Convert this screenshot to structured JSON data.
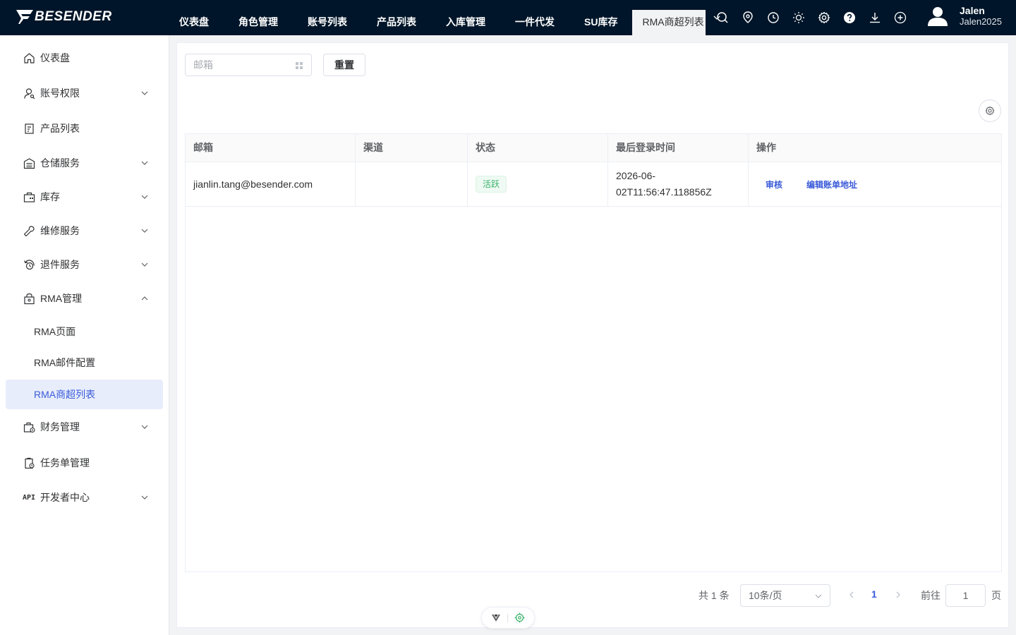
{
  "brand": {
    "name": "BESENDER"
  },
  "topnav": {
    "items": [
      {
        "label": "仪表盘"
      },
      {
        "label": "角色管理"
      },
      {
        "label": "账号列表"
      },
      {
        "label": "产品列表"
      },
      {
        "label": "入库管理"
      },
      {
        "label": "一件代发"
      },
      {
        "label": "SU库存"
      }
    ],
    "active": {
      "label": "RMA商超列表"
    },
    "icons": [
      "search-icon",
      "location-icon",
      "clock-icon",
      "sun-icon",
      "gear-icon",
      "help-icon",
      "download-icon",
      "plus-circle-icon"
    ]
  },
  "user": {
    "name": "Jalen",
    "username": "Jalen2025"
  },
  "sidebar": {
    "items": [
      {
        "label": "仪表盘",
        "icon": "home-icon"
      },
      {
        "label": "账号权限",
        "icon": "user-key-icon"
      },
      {
        "label": "产品列表",
        "icon": "clipboard-icon"
      },
      {
        "label": "仓储服务",
        "icon": "warehouse-icon"
      },
      {
        "label": "库存",
        "icon": "inventory-icon"
      },
      {
        "label": "维修服务",
        "icon": "wrench-icon"
      },
      {
        "label": "退件服务",
        "icon": "return-icon"
      },
      {
        "label": "RMA管理",
        "icon": "lock-bag-icon"
      },
      {
        "label": "财务管理",
        "icon": "finance-icon"
      },
      {
        "label": "任务单管理",
        "icon": "task-icon"
      },
      {
        "label": "开发者中心",
        "icon": "api-icon",
        "tag": "API"
      }
    ],
    "rma_sub": [
      {
        "label": "RMA页面"
      },
      {
        "label": "RMA邮件配置"
      },
      {
        "label": "RMA商超列表"
      }
    ]
  },
  "filters": {
    "email_placeholder": "邮箱",
    "reset_label": "重置"
  },
  "table": {
    "columns": [
      "邮箱",
      "渠道",
      "状态",
      "最后登录时间",
      "操作"
    ],
    "rows": [
      {
        "email": "jianlin.tang@besender.com",
        "channel": "",
        "status": "活跃",
        "last_login_line1": "2026-06-",
        "last_login_line2": "02T11:56:47.118856Z",
        "action_review": "审核",
        "action_edit": "编辑账单地址"
      }
    ]
  },
  "pagination": {
    "total": "共 1 条",
    "page_size": "10条/页",
    "current_page": "1",
    "goto_label": "前往",
    "goto_value": "1",
    "page_suffix": "页"
  },
  "colors": {
    "topbar_bg": "#001529",
    "accent": "#3a5bd9",
    "selected_bg": "#e8edfb",
    "success": "#3bb26b"
  }
}
